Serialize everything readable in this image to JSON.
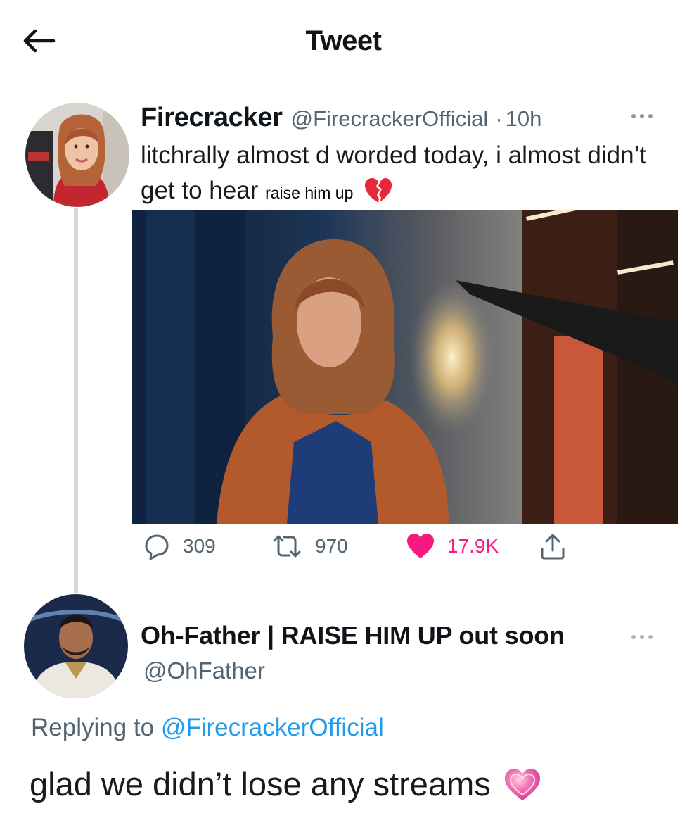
{
  "header": {
    "title": "Tweet",
    "back_icon": "arrow-left-icon"
  },
  "tweet": {
    "author_name": "Firecracker",
    "handle": "@FirecrackerOfficial",
    "separator": "·",
    "time": "10h",
    "more_icon": "more-horizontal-icon",
    "text_main": "litchrally almost d worded today, i almost didn’t get to hear",
    "text_small": "raise him up",
    "emoji": "broken-heart-icon",
    "stats": {
      "replies": "309",
      "retweets": "970",
      "likes": "17.9K"
    },
    "liked": true,
    "colors": {
      "like": "#f91880",
      "muted": "#536471"
    }
  },
  "reply": {
    "author_name": "Oh-Father | RAISE HIM UP out soon",
    "handle": "@OhFather",
    "more_icon": "more-horizontal-icon",
    "replying_label": "Replying to",
    "replying_to": "@FirecrackerOfficial",
    "text": "glad we didn’t lose any streams",
    "emoji": "pink-heart-icon",
    "colors": {
      "link": "#1d9bf0"
    }
  }
}
